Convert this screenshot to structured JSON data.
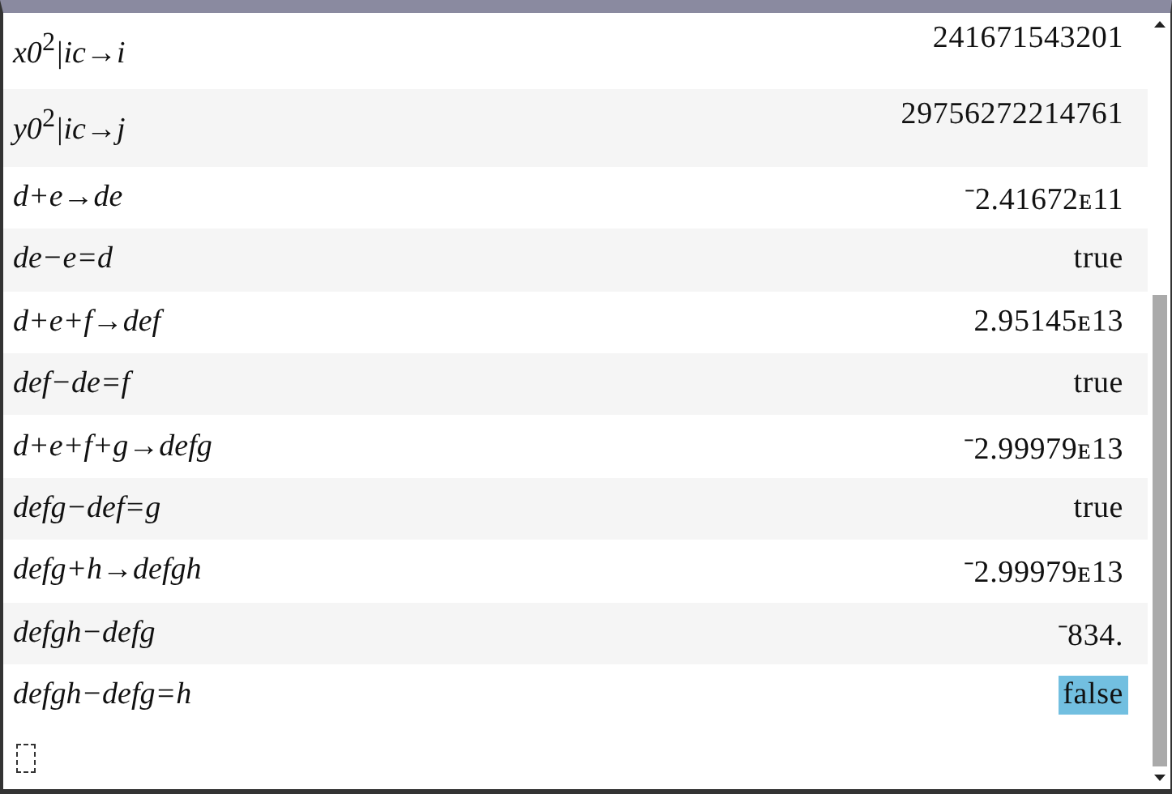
{
  "entries": [
    {
      "input": "x0$^{2}$|ic→i",
      "result": "241671543201",
      "selected": false
    },
    {
      "input": "y0$^{2}$|ic→j",
      "result": "29756272214761",
      "selected": false
    },
    {
      "input": "d+e→de",
      "result": "⁻2.41672ᴇ11",
      "selected": false
    },
    {
      "input": "de−e=d",
      "result": "true",
      "selected": false
    },
    {
      "input": "d+e+f→def",
      "result": "2.95145ᴇ13",
      "selected": false
    },
    {
      "input": "def−de=f",
      "result": "true",
      "selected": false
    },
    {
      "input": "d+e+f+g→defg",
      "result": "⁻2.99979ᴇ13",
      "selected": false
    },
    {
      "input": "defg−def=g",
      "result": "true",
      "selected": false
    },
    {
      "input": "defg+h→defgh",
      "result": "⁻2.99979ᴇ13",
      "selected": false
    },
    {
      "input": "defgh−defg",
      "result": "⁻834.",
      "selected": false
    },
    {
      "input": "defgh−defg=h",
      "result": "false",
      "selected": true
    }
  ]
}
